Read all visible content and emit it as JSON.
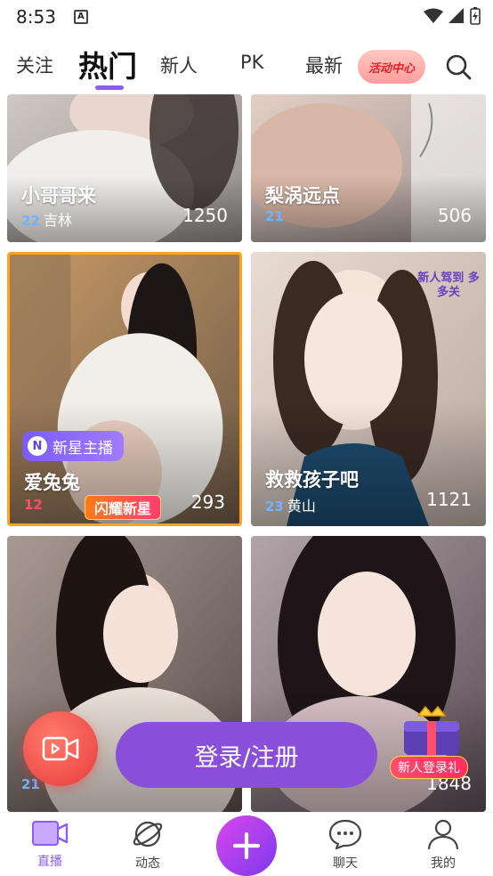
{
  "status_bar": {
    "time": "8:53",
    "notification_letter": "A"
  },
  "tabs": [
    {
      "label": "关注"
    },
    {
      "label": "热门",
      "active": true
    },
    {
      "label": "新人"
    },
    {
      "label": "PK"
    },
    {
      "label": "最新"
    }
  ],
  "activity_center": "活动中心",
  "cards": [
    {
      "title": "小哥哥来",
      "level": "22",
      "location": "吉林",
      "viewers": "1250"
    },
    {
      "title": "梨涡远点",
      "level": "21",
      "location": "",
      "viewers": "506"
    },
    {
      "title": "爱兔兔",
      "level": "12",
      "location": "",
      "viewers": "293",
      "badge": "新星主播",
      "banner": "闪耀新星"
    },
    {
      "title": "救救孩子吧",
      "level": "23",
      "location": "黄山",
      "viewers": "1121",
      "overlay": "新人驾到 多多关"
    },
    {
      "title": "",
      "level": "21",
      "location": "",
      "viewers": ""
    },
    {
      "title": "",
      "level": "",
      "location": "",
      "viewers": "1848"
    }
  ],
  "login_button": "登录/注册",
  "gift_label": "新人登录礼",
  "bottom_nav": [
    {
      "label": "直播",
      "icon": "live-video-icon",
      "active": true
    },
    {
      "label": "动态",
      "icon": "planet-icon"
    },
    {
      "label": "",
      "icon": "plus-icon"
    },
    {
      "label": "聊天",
      "icon": "chat-bubble-icon"
    },
    {
      "label": "我的",
      "icon": "person-icon"
    }
  ],
  "colors": {
    "accent": "#8b5cf6",
    "login": "#8a4fd8",
    "record_fab": "#e83c3c"
  }
}
